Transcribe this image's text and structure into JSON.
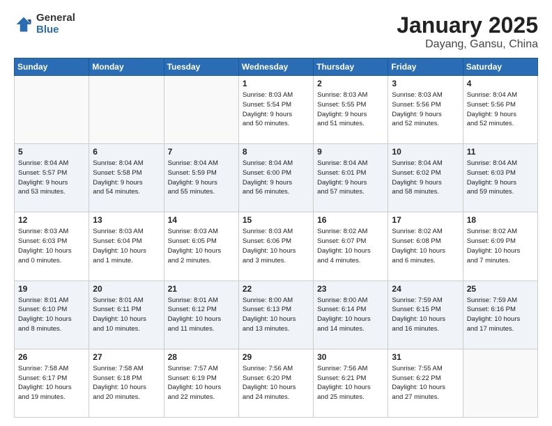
{
  "logo": {
    "general": "General",
    "blue": "Blue"
  },
  "title": {
    "month": "January 2025",
    "location": "Dayang, Gansu, China"
  },
  "weekdays": [
    "Sunday",
    "Monday",
    "Tuesday",
    "Wednesday",
    "Thursday",
    "Friday",
    "Saturday"
  ],
  "weeks": [
    [
      {
        "day": "",
        "info": ""
      },
      {
        "day": "",
        "info": ""
      },
      {
        "day": "",
        "info": ""
      },
      {
        "day": "1",
        "info": "Sunrise: 8:03 AM\nSunset: 5:54 PM\nDaylight: 9 hours\nand 50 minutes."
      },
      {
        "day": "2",
        "info": "Sunrise: 8:03 AM\nSunset: 5:55 PM\nDaylight: 9 hours\nand 51 minutes."
      },
      {
        "day": "3",
        "info": "Sunrise: 8:03 AM\nSunset: 5:56 PM\nDaylight: 9 hours\nand 52 minutes."
      },
      {
        "day": "4",
        "info": "Sunrise: 8:04 AM\nSunset: 5:56 PM\nDaylight: 9 hours\nand 52 minutes."
      }
    ],
    [
      {
        "day": "5",
        "info": "Sunrise: 8:04 AM\nSunset: 5:57 PM\nDaylight: 9 hours\nand 53 minutes."
      },
      {
        "day": "6",
        "info": "Sunrise: 8:04 AM\nSunset: 5:58 PM\nDaylight: 9 hours\nand 54 minutes."
      },
      {
        "day": "7",
        "info": "Sunrise: 8:04 AM\nSunset: 5:59 PM\nDaylight: 9 hours\nand 55 minutes."
      },
      {
        "day": "8",
        "info": "Sunrise: 8:04 AM\nSunset: 6:00 PM\nDaylight: 9 hours\nand 56 minutes."
      },
      {
        "day": "9",
        "info": "Sunrise: 8:04 AM\nSunset: 6:01 PM\nDaylight: 9 hours\nand 57 minutes."
      },
      {
        "day": "10",
        "info": "Sunrise: 8:04 AM\nSunset: 6:02 PM\nDaylight: 9 hours\nand 58 minutes."
      },
      {
        "day": "11",
        "info": "Sunrise: 8:04 AM\nSunset: 6:03 PM\nDaylight: 9 hours\nand 59 minutes."
      }
    ],
    [
      {
        "day": "12",
        "info": "Sunrise: 8:03 AM\nSunset: 6:03 PM\nDaylight: 10 hours\nand 0 minutes."
      },
      {
        "day": "13",
        "info": "Sunrise: 8:03 AM\nSunset: 6:04 PM\nDaylight: 10 hours\nand 1 minute."
      },
      {
        "day": "14",
        "info": "Sunrise: 8:03 AM\nSunset: 6:05 PM\nDaylight: 10 hours\nand 2 minutes."
      },
      {
        "day": "15",
        "info": "Sunrise: 8:03 AM\nSunset: 6:06 PM\nDaylight: 10 hours\nand 3 minutes."
      },
      {
        "day": "16",
        "info": "Sunrise: 8:02 AM\nSunset: 6:07 PM\nDaylight: 10 hours\nand 4 minutes."
      },
      {
        "day": "17",
        "info": "Sunrise: 8:02 AM\nSunset: 6:08 PM\nDaylight: 10 hours\nand 6 minutes."
      },
      {
        "day": "18",
        "info": "Sunrise: 8:02 AM\nSunset: 6:09 PM\nDaylight: 10 hours\nand 7 minutes."
      }
    ],
    [
      {
        "day": "19",
        "info": "Sunrise: 8:01 AM\nSunset: 6:10 PM\nDaylight: 10 hours\nand 8 minutes."
      },
      {
        "day": "20",
        "info": "Sunrise: 8:01 AM\nSunset: 6:11 PM\nDaylight: 10 hours\nand 10 minutes."
      },
      {
        "day": "21",
        "info": "Sunrise: 8:01 AM\nSunset: 6:12 PM\nDaylight: 10 hours\nand 11 minutes."
      },
      {
        "day": "22",
        "info": "Sunrise: 8:00 AM\nSunset: 6:13 PM\nDaylight: 10 hours\nand 13 minutes."
      },
      {
        "day": "23",
        "info": "Sunrise: 8:00 AM\nSunset: 6:14 PM\nDaylight: 10 hours\nand 14 minutes."
      },
      {
        "day": "24",
        "info": "Sunrise: 7:59 AM\nSunset: 6:15 PM\nDaylight: 10 hours\nand 16 minutes."
      },
      {
        "day": "25",
        "info": "Sunrise: 7:59 AM\nSunset: 6:16 PM\nDaylight: 10 hours\nand 17 minutes."
      }
    ],
    [
      {
        "day": "26",
        "info": "Sunrise: 7:58 AM\nSunset: 6:17 PM\nDaylight: 10 hours\nand 19 minutes."
      },
      {
        "day": "27",
        "info": "Sunrise: 7:58 AM\nSunset: 6:18 PM\nDaylight: 10 hours\nand 20 minutes."
      },
      {
        "day": "28",
        "info": "Sunrise: 7:57 AM\nSunset: 6:19 PM\nDaylight: 10 hours\nand 22 minutes."
      },
      {
        "day": "29",
        "info": "Sunrise: 7:56 AM\nSunset: 6:20 PM\nDaylight: 10 hours\nand 24 minutes."
      },
      {
        "day": "30",
        "info": "Sunrise: 7:56 AM\nSunset: 6:21 PM\nDaylight: 10 hours\nand 25 minutes."
      },
      {
        "day": "31",
        "info": "Sunrise: 7:55 AM\nSunset: 6:22 PM\nDaylight: 10 hours\nand 27 minutes."
      },
      {
        "day": "",
        "info": ""
      }
    ]
  ]
}
